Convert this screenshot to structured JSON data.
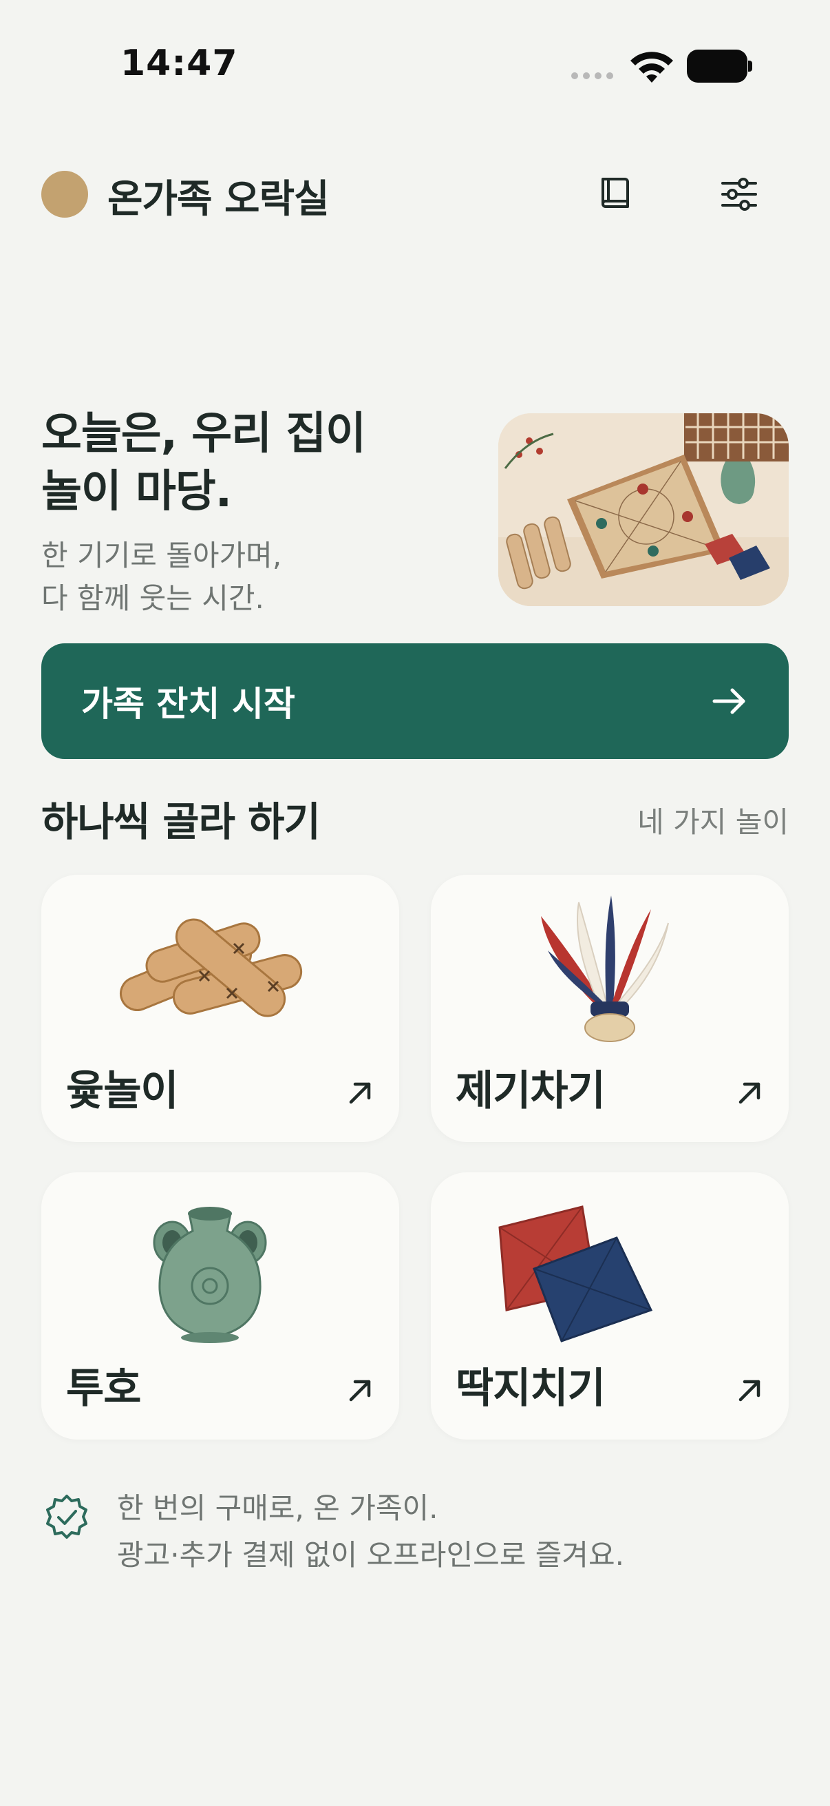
{
  "status_bar": {
    "time": "14:47"
  },
  "header": {
    "title": "온가족 오락실",
    "icons": [
      "book-icon",
      "settings-sliders-icon"
    ]
  },
  "hero": {
    "title_line1": "오늘은, 우리 집이",
    "title_line2": "놀이 마당.",
    "subtitle_line1": "한 기기로 돌아가며,",
    "subtitle_line2": "다 함께 웃는 시간."
  },
  "cta": {
    "label": "가족 잔치 시작",
    "icon": "arrow-right-icon"
  },
  "games_section": {
    "title": "하나씩 골라 하기",
    "meta": "네 가지 놀이",
    "games": [
      {
        "label": "윷놀이",
        "icon": "yut-sticks-image"
      },
      {
        "label": "제기차기",
        "icon": "jegi-image"
      },
      {
        "label": "투호",
        "icon": "tuho-vase-image"
      },
      {
        "label": "딱지치기",
        "icon": "ddakji-image"
      }
    ]
  },
  "footer_note": {
    "line1": "한 번의 구매로, 온 가족이.",
    "line2": "광고·추가 결제 없이 오프라인으로 즐겨요."
  },
  "colors": {
    "background": "#f3f4f1",
    "primary": "#1f6758",
    "accent_gold": "#c3a270",
    "card": "#fbfbf8"
  }
}
